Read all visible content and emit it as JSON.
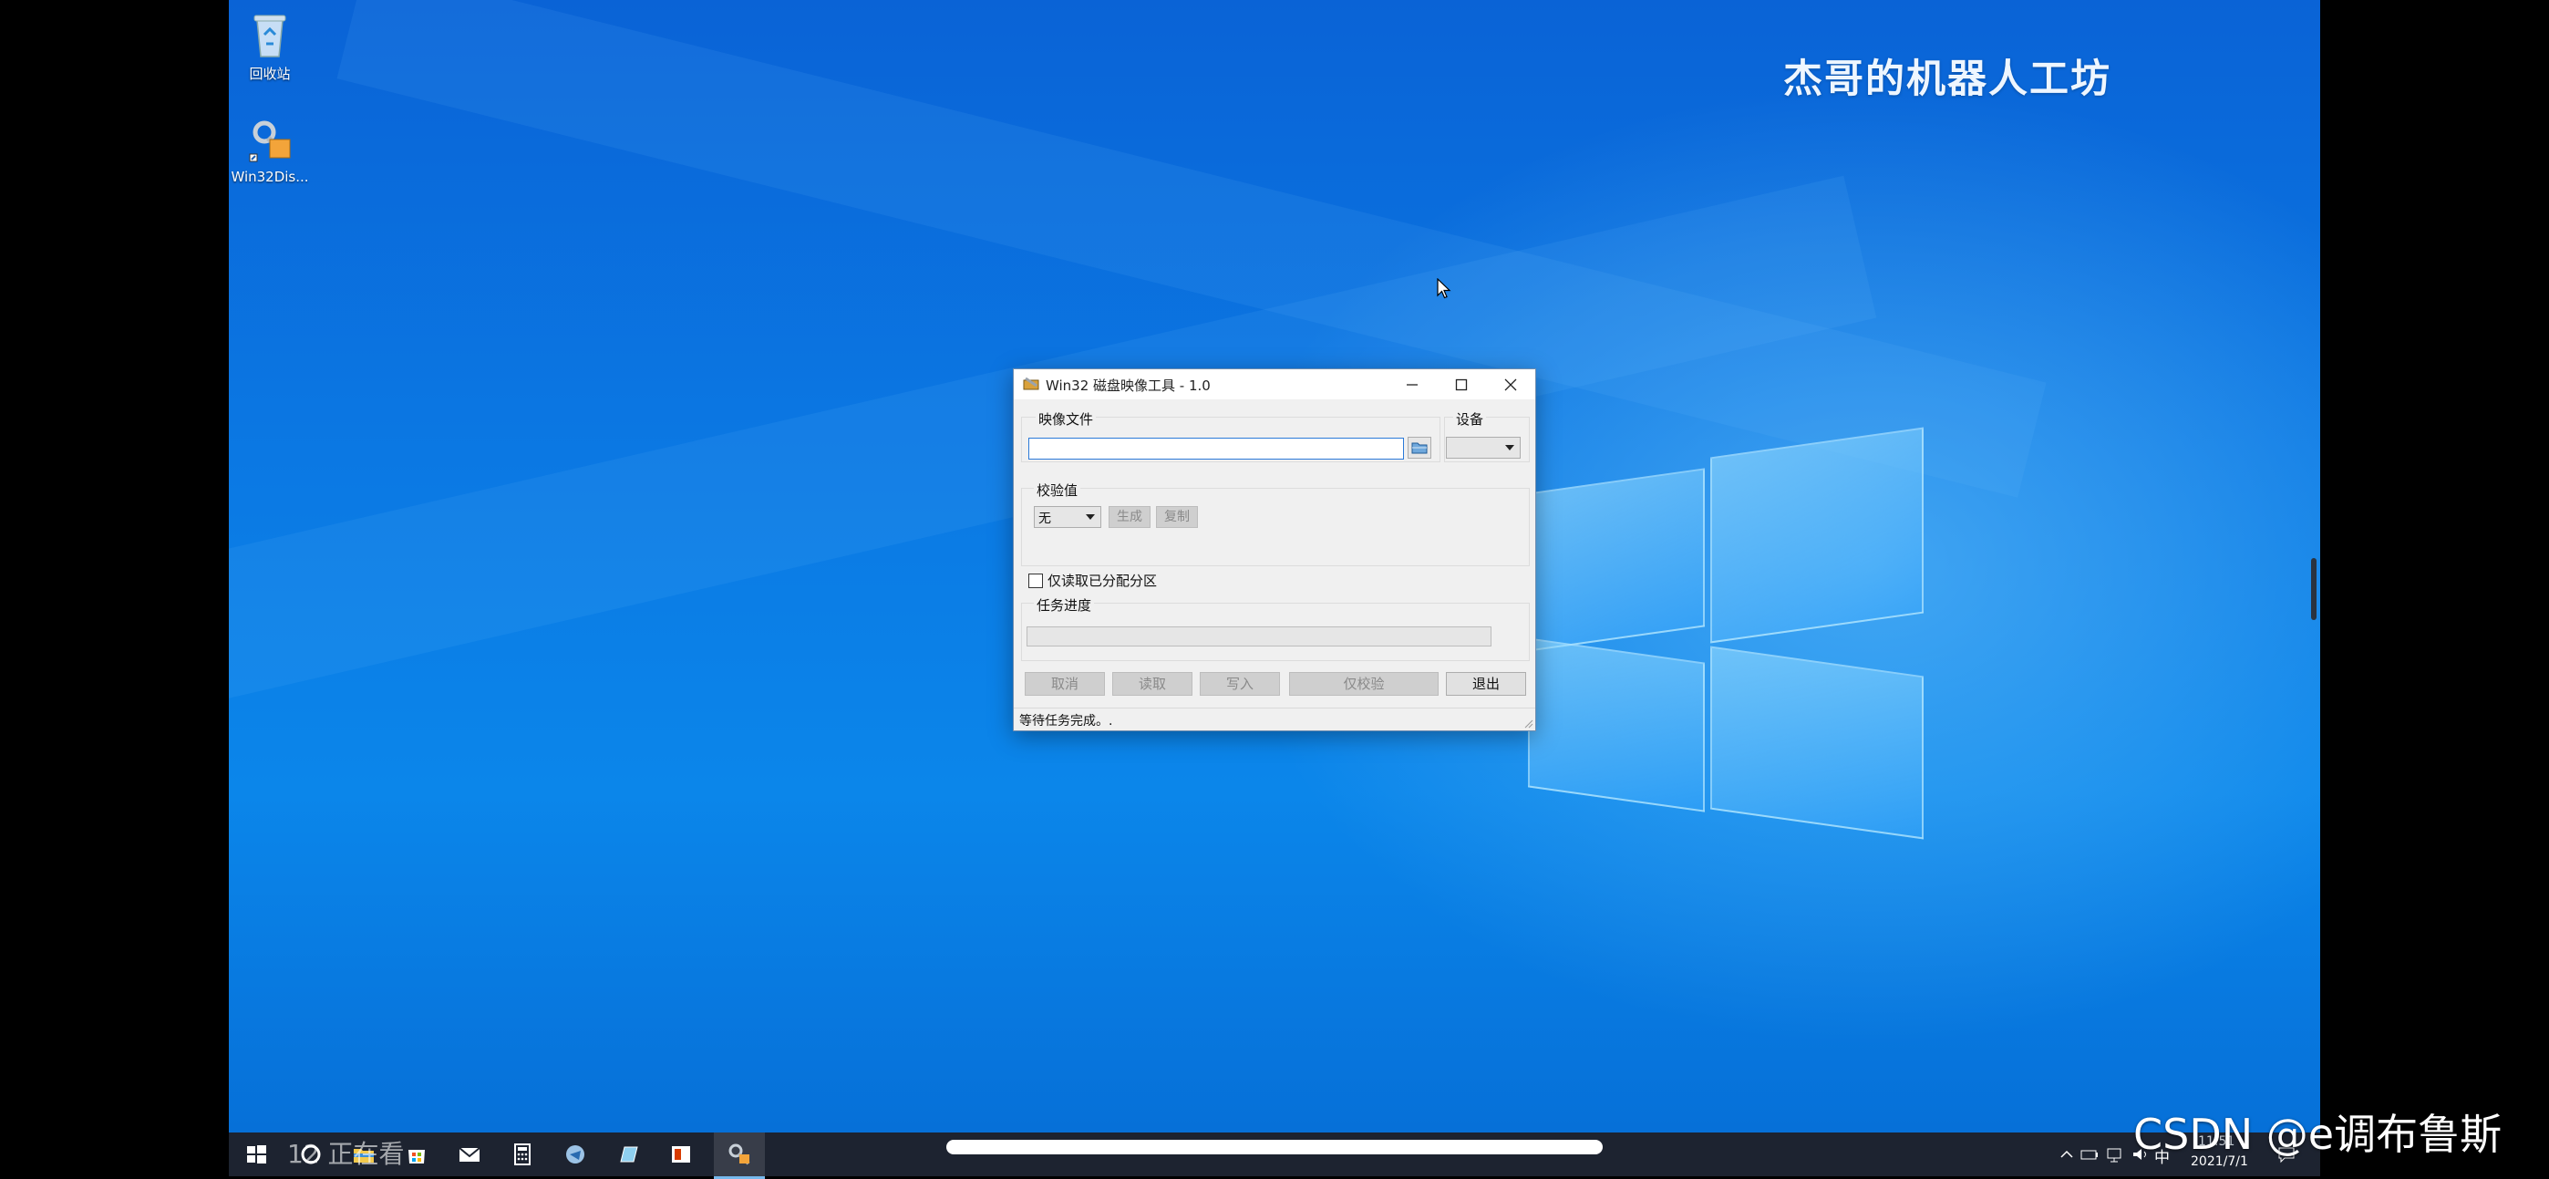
{
  "desktop": {
    "icons": [
      {
        "label": "回收站",
        "icon": "recycle-bin-icon"
      },
      {
        "label": "Win32Dis...",
        "icon": "win32-disk-imager-icon"
      }
    ],
    "watermark": {
      "text": "杰哥的机器人工坊",
      "logo": "bilibili"
    }
  },
  "dialog": {
    "title": "Win32 磁盘映像工具 - 1.0",
    "image_file_label": "映像文件",
    "image_file_value": "",
    "device_label": "设备",
    "device_value": "",
    "checksum_label": "校验值",
    "checksum_type": "无",
    "generate_label": "生成",
    "copy_label": "复制",
    "read_only_partitions_label": "仅读取已分配分区",
    "read_only_partitions_checked": false,
    "progress_label": "任务进度",
    "progress_fraction": 0,
    "buttons": {
      "cancel": "取消",
      "read": "读取",
      "write": "写入",
      "verify_only": "仅校验",
      "exit": "退出"
    },
    "status": "等待任务完成。."
  },
  "taskbar": {
    "viewers_text": "12 正在看",
    "tray_lang": "中",
    "tray_time": "11:51",
    "tray_date": "2021/7/1"
  },
  "overlay": {
    "csdn_watermark": "CSDN @e调布鲁斯"
  }
}
